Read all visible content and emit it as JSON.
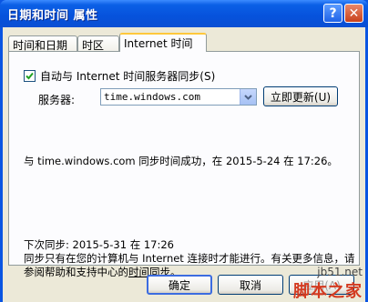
{
  "window": {
    "title": "日期和时间 属性"
  },
  "titlebar": {
    "help_label": "?",
    "close_label": "✕"
  },
  "tabs": [
    {
      "label": "时间和日期",
      "active": false
    },
    {
      "label": "时区",
      "active": false
    },
    {
      "label": "Internet 时间",
      "active": true
    }
  ],
  "sync": {
    "checkbox_label": "自动与 Internet 时间服务器同步(S)",
    "checked": true,
    "server_label": "服务器:",
    "server_value": "time.windows.com",
    "update_button": "立即更新(U)"
  },
  "status": {
    "success_message": "与 time.windows.com 同步时间成功，在 2015-5-24 在 17:26。",
    "next_sync": "下次同步: 2015-5-31 在 17:26",
    "note_prefix": "同步只有在您的计算机与 Internet 连接时才能进行。有关更多信息，请参阅帮助和支持中心的",
    "note_link": "时间同步",
    "note_suffix": "。"
  },
  "footer": {
    "ok_label": "确定",
    "cancel_label": "取消",
    "apply_label": "应用(A)"
  },
  "watermark": {
    "url": "jb51.net",
    "name": "脚本之家"
  },
  "colors": {
    "titlebar": "#0652dc",
    "dialog": "#ece9d8",
    "accent": "#d43a20"
  }
}
